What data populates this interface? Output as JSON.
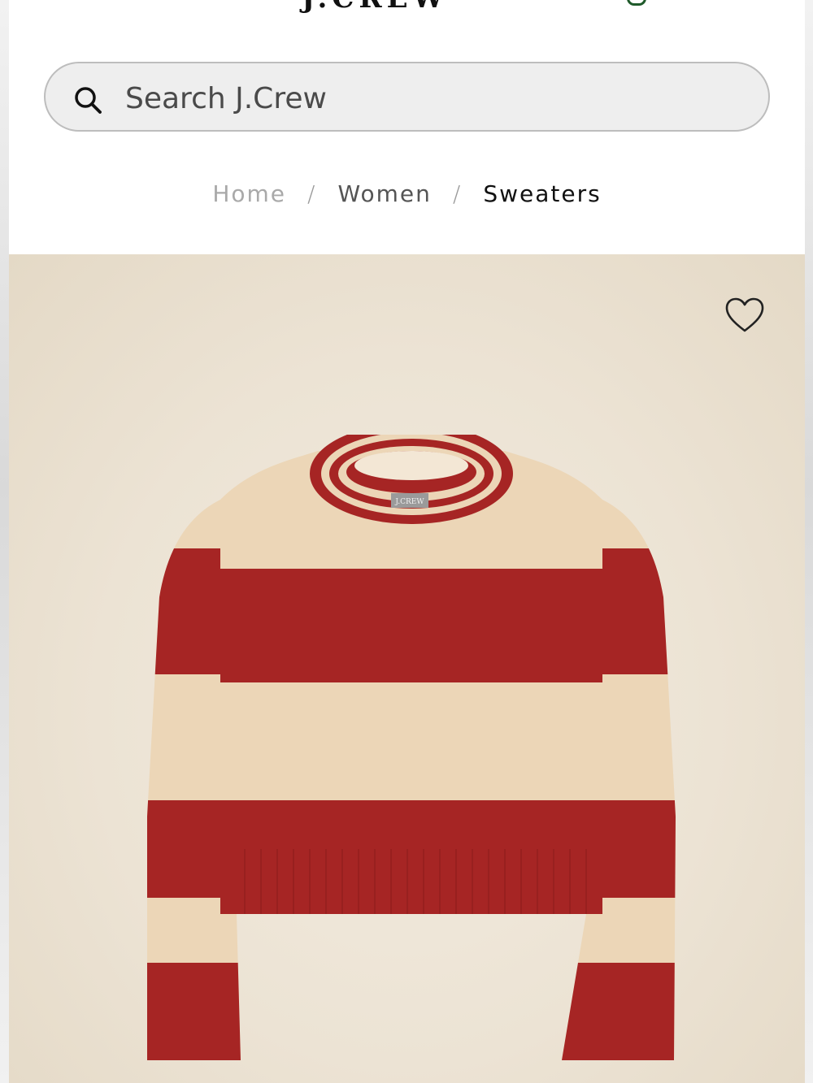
{
  "header": {
    "logo_text": "J.CREW"
  },
  "search": {
    "placeholder": "Search J.Crew"
  },
  "breadcrumb": {
    "items": [
      "Home",
      "Women",
      "Sweaters"
    ],
    "separator": "/"
  },
  "product": {
    "label_text": "J.CREW"
  },
  "colors": {
    "sweater_red": "#a62524",
    "sweater_cream": "#ecd6b7",
    "background": "#ede5d7",
    "bag_green": "#1f5a2a"
  },
  "icons": [
    "search-icon",
    "heart-icon",
    "bag-icon"
  ]
}
